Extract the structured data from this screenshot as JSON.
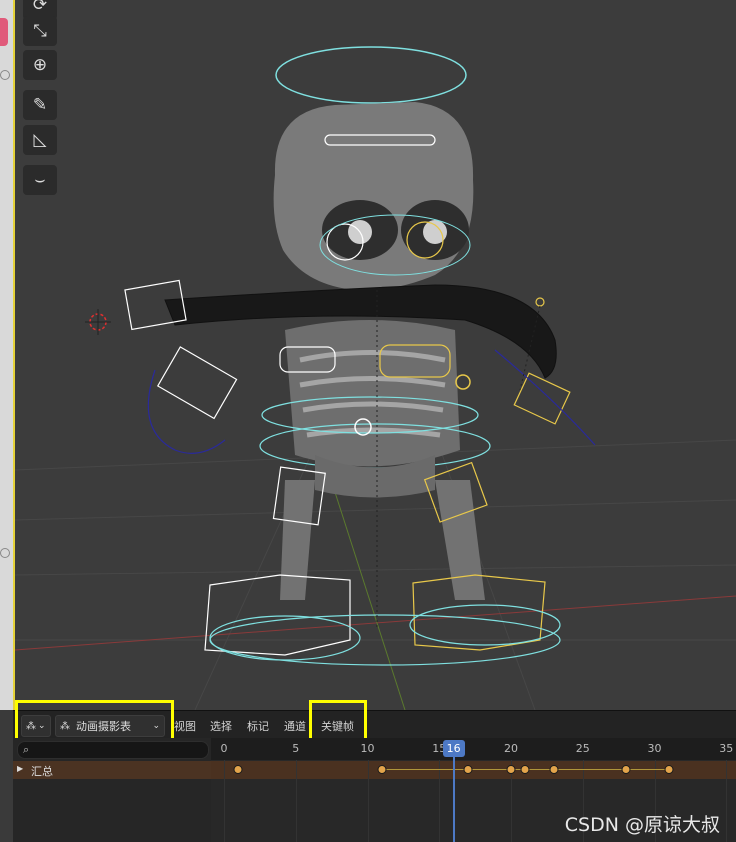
{
  "editor": {
    "mode_label": "动画摄影表",
    "menus": [
      "视图",
      "选择",
      "标记",
      "通道",
      "关键帧"
    ],
    "search": {
      "placeholder": ""
    },
    "channels": [
      {
        "label": "汇总",
        "expanded": false
      }
    ]
  },
  "timeline": {
    "ticks": [
      "0",
      "5",
      "10",
      "15",
      "20",
      "25",
      "30",
      "35"
    ],
    "current_frame": "16",
    "keyframes": [
      1,
      11,
      17,
      20,
      21,
      23,
      28,
      31
    ]
  },
  "viewport": {
    "tools": [
      "scale-icon",
      "transform-icon",
      "annotate-icon",
      "measure-icon",
      "curve-icon"
    ]
  },
  "colors": {
    "highlight": "#ffff00",
    "playhead": "#4d79c5",
    "keyframe": "#e3a44b",
    "bone_selected": "#e8c84a",
    "bone_cyan": "#7fe0e0"
  },
  "watermark": "CSDN @原谅大叔"
}
